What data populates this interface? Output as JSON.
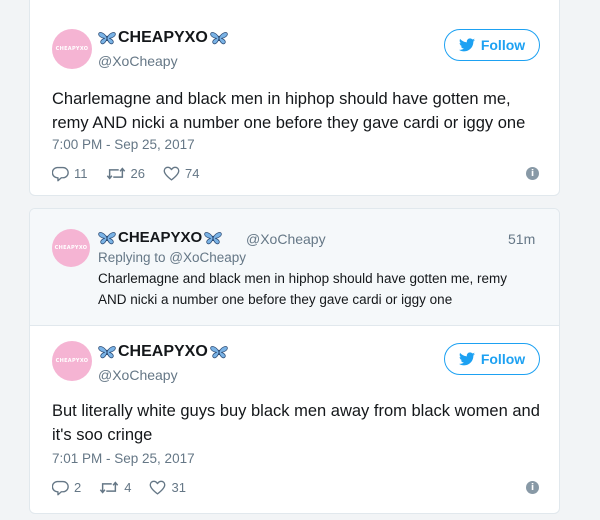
{
  "colors": {
    "accent": "#1da1f2",
    "muted": "#657786",
    "avatar": "#f5b4d3"
  },
  "tweet1": {
    "avatar_text": "CHEAPYXO",
    "display_name": "CHEAPYXO",
    "handle": "@XoCheapy",
    "follow_label": "Follow",
    "text_line1": "Charlemagne and black men in hiphop should have gotten me,",
    "text_line2": "remy AND nicki a number one before they gave cardi or iggy one",
    "timestamp": "7:00 PM - Sep 25, 2017",
    "replies": "11",
    "retweets": "26",
    "likes": "74"
  },
  "quoted": {
    "avatar_text": "CHEAPYXO",
    "display_name": "CHEAPYXO",
    "handle": "@XoCheapy",
    "age": "51m",
    "replying_to": "Replying to @XoCheapy",
    "text_line1": "Charlemagne and black men in hiphop should have gotten me, remy",
    "text_line2": "AND nicki a number one before they gave cardi or iggy one"
  },
  "tweet2": {
    "avatar_text": "CHEAPYXO",
    "display_name": "CHEAPYXO",
    "handle": "@XoCheapy",
    "follow_label": "Follow",
    "text_line1": "But literally white guys buy black men away from black women and",
    "text_line2": "it's soo cringe",
    "timestamp": "7:01 PM - Sep 25, 2017",
    "replies": "2",
    "retweets": "4",
    "likes": "31"
  }
}
